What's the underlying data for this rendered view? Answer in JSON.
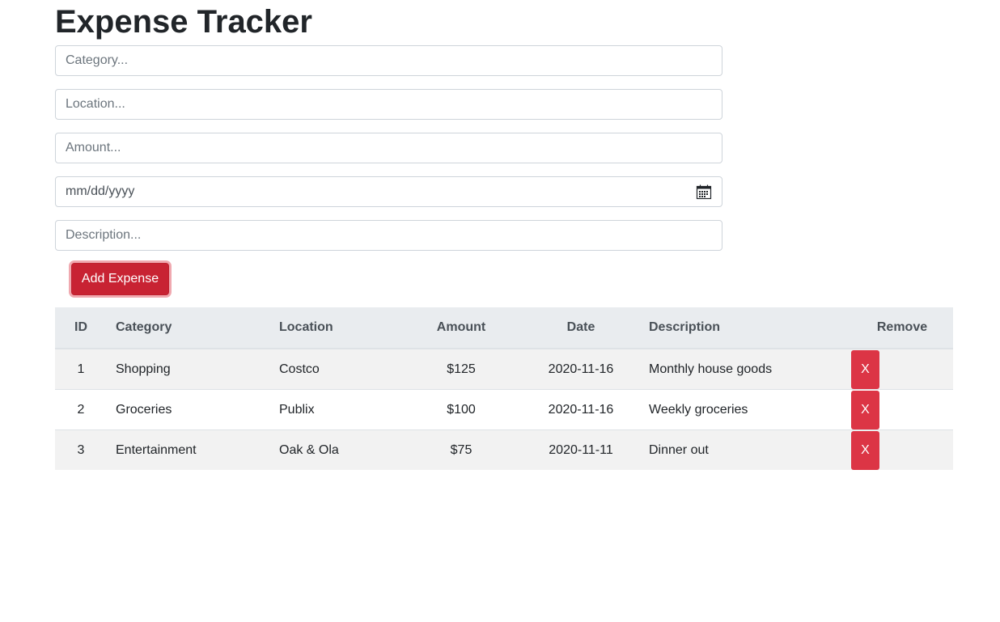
{
  "title": "Expense Tracker",
  "form": {
    "category_placeholder": "Category...",
    "location_placeholder": "Location...",
    "amount_placeholder": "Amount...",
    "date_placeholder": "mm/dd/yyyy",
    "description_placeholder": "Description...",
    "add_label": "Add Expense"
  },
  "table": {
    "headers": [
      "ID",
      "Category",
      "Location",
      "Amount",
      "Date",
      "Description",
      "Remove"
    ],
    "rows": [
      {
        "id": "1",
        "category": "Shopping",
        "location": "Costco",
        "amount": "$125",
        "date": "2020-11-16",
        "description": "Monthly house goods",
        "remove": "X"
      },
      {
        "id": "2",
        "category": "Groceries",
        "location": "Publix",
        "amount": "$100",
        "date": "2020-11-16",
        "description": "Weekly groceries",
        "remove": "X"
      },
      {
        "id": "3",
        "category": "Entertainment",
        "location": "Oak & Ola",
        "amount": "$75",
        "date": "2020-11-11",
        "description": "Dinner out",
        "remove": "X"
      }
    ]
  },
  "colors": {
    "danger": "#dc3545",
    "danger_active": "#c82333",
    "header_bg": "#e9ecef",
    "stripe_bg": "#f2f2f2"
  },
  "icons": {
    "date_picker": "calendar-icon"
  }
}
